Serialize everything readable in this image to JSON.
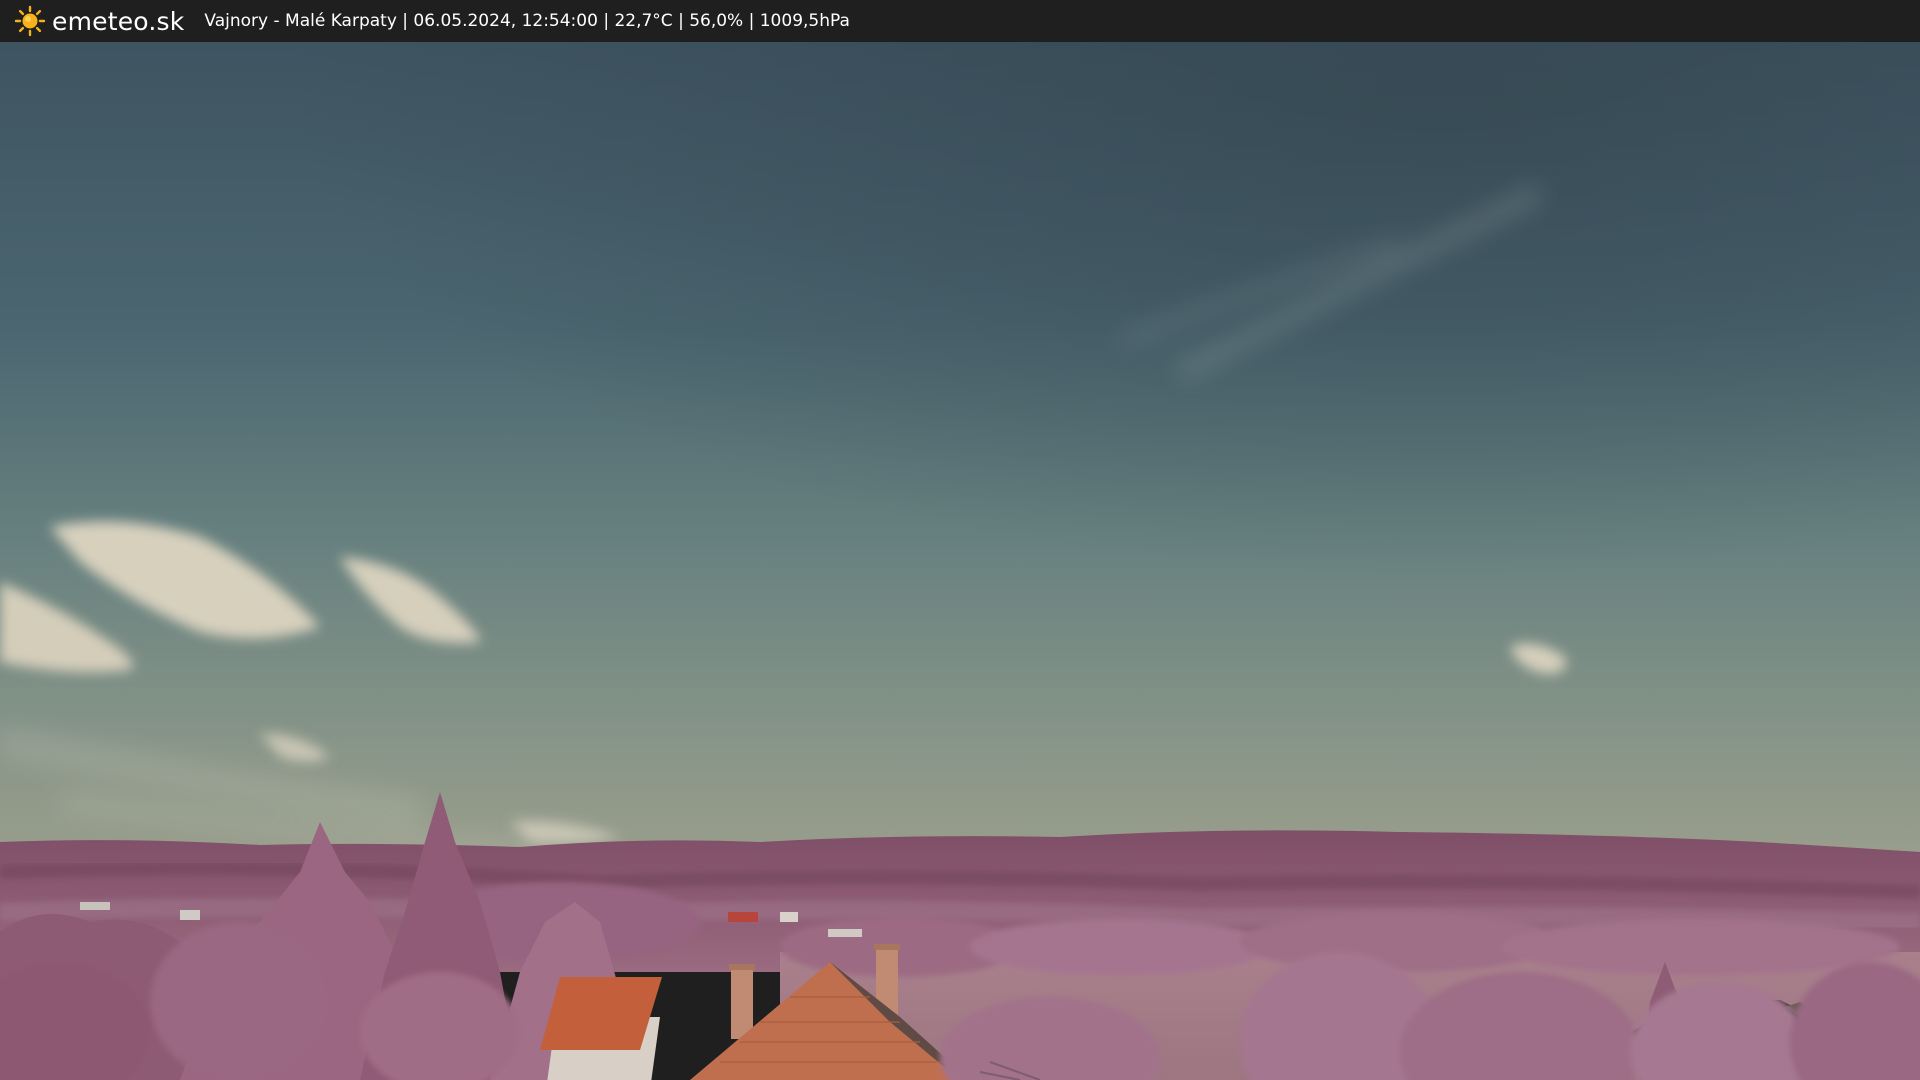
{
  "header": {
    "brand": "emeteo.sk",
    "logo_icon": "sun-icon",
    "caption": "Vajnory - Malé Karpaty | 06.05.2024, 12:54:00 | 22,7°C | 56,0% | 1009,5hPa"
  },
  "colors": {
    "bar_background": "#1f1f1f",
    "sun": "#f5b21a",
    "sky_top": "#3f5664",
    "sky_horizon": "#8e9a86",
    "hills": "#8a5a72",
    "foliage": "#a06a84",
    "roof": "#c8643e"
  }
}
